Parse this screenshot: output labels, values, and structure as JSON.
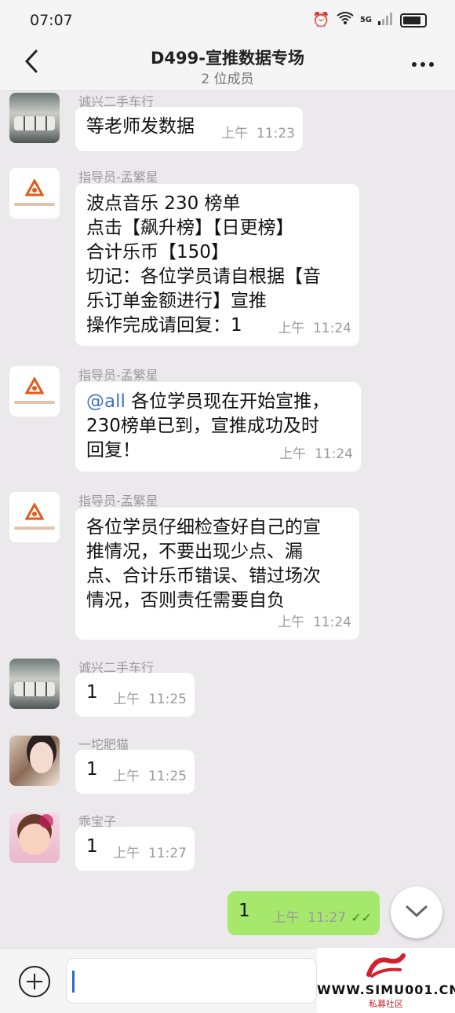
{
  "status_bar": {
    "time": "07:07",
    "icons": [
      "alarm-icon",
      "wifi-icon",
      "5g-signal-icon",
      "battery-icon"
    ],
    "network_label": "5G"
  },
  "header": {
    "title": "D499-宣推数据专场",
    "subtitle": "2 位成员"
  },
  "messages": [
    {
      "sender": "诚兴二手车行",
      "lines": [
        "等老师发数据"
      ],
      "time": "上午  11:23"
    },
    {
      "sender": "指导员-孟繁星",
      "lines": [
        "波点音乐 230 榜单",
        "点击【飙升榜】【日更榜】",
        "合计乐币【150】",
        "切记：各位学员请自根据【音",
        "乐订单金额进行】宣推",
        "操作完成请回复：1"
      ],
      "time": "上午  11:24"
    },
    {
      "sender": "指导员-孟繁星",
      "mention": "@all",
      "lines": [
        " 各位学员现在开始宣推，",
        "230榜单已到，宣推成功及时",
        "回复！"
      ],
      "time": "上午  11:24"
    },
    {
      "sender": "指导员-孟繁星",
      "lines": [
        "各位学员仔细检查好自己的宣",
        "推情况，不要出现少点、漏",
        "点、合计乐币错误、错过场次",
        "情况，否则责任需要自负"
      ],
      "time": "上午  11:24"
    },
    {
      "sender": "诚兴二手车行",
      "lines": [
        "1"
      ],
      "time": "上午  11:25"
    },
    {
      "sender": "一坨肥猫",
      "lines": [
        "1"
      ],
      "time": "上午  11:25"
    },
    {
      "sender": "乖宝子",
      "lines": [
        "1"
      ],
      "time": "上午  11:27"
    }
  ],
  "self_message": {
    "text": "1",
    "time": "上午  11:27",
    "status": "✓✓"
  },
  "input": {
    "placeholder": ""
  },
  "watermark": {
    "text": "WWW.SIMU001.CN",
    "sub": "私募社区"
  },
  "colors": {
    "self_bubble": "#a6e86c",
    "mention": "#3e72c7",
    "chat_bg": "#ece9ec"
  }
}
